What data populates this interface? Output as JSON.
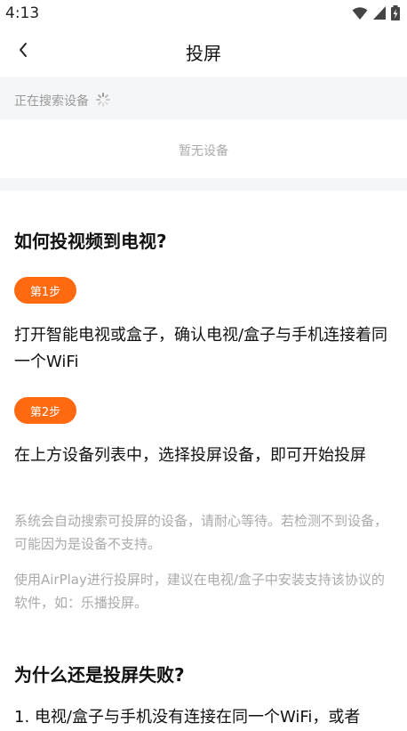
{
  "status": {
    "time": "4:13"
  },
  "nav": {
    "title": "投屏"
  },
  "search": {
    "label": "正在搜索设备"
  },
  "devices": {
    "empty_text": "暂无设备"
  },
  "guide": {
    "title": "如何投视频到电视?",
    "steps": [
      {
        "badge": "第1步",
        "text": "打开智能电视或盒子，确认电视/盒子与手机连接着同一个WiFi"
      },
      {
        "badge": "第2步",
        "text": "在上方设备列表中，选择投屏设备，即可开始投屏"
      }
    ],
    "notes": [
      "系统会自动搜索可投屏的设备，请耐心等待。若检测不到设备，可能因为是设备不支持。",
      "使用AirPlay进行投屏时，建议在电视/盒子中安装支持该协议的软件，如：乐播投屏。"
    ]
  },
  "faq": {
    "title": "为什么还是投屏失败?",
    "items": [
      "1. 电视/盒子与手机没有连接在同一个WiFi，或者"
    ]
  },
  "colors": {
    "accent": "#ff6a11",
    "strip_bg": "#f5f6f8",
    "muted": "#aaaaaa"
  }
}
